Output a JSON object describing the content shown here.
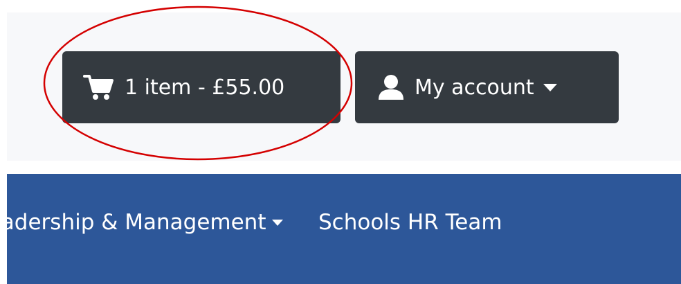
{
  "header": {
    "cart": {
      "label": "1 item - £55.00",
      "icon": "cart-icon"
    },
    "account": {
      "label": "My account",
      "icon": "user-icon",
      "dropdown_icon": "caret-down-icon"
    }
  },
  "nav": {
    "items": [
      {
        "label": "Leadership & Management",
        "has_dropdown": true
      },
      {
        "label": "Schools HR Team",
        "has_dropdown": false
      }
    ]
  },
  "colors": {
    "button_bg": "#343a40",
    "topbar_bg": "#f7f8fa",
    "nav_bg": "#2d5799",
    "annotation": "#d40000"
  }
}
